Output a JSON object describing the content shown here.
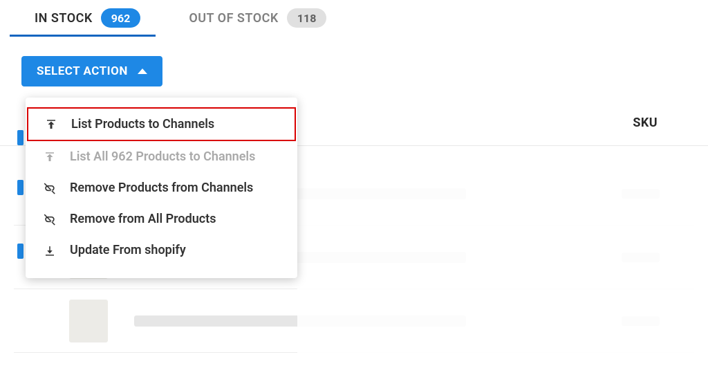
{
  "tabs": {
    "in_stock": {
      "label": "IN STOCK",
      "count": "962"
    },
    "out_of_stock": {
      "label": "OUT OF STOCK",
      "count": "118"
    }
  },
  "select_action": {
    "label": "SELECT ACTION"
  },
  "menu": {
    "list_products": "List Products to Channels",
    "list_all": "List All 962 Products to Channels",
    "remove_products": "Remove Products from Channels",
    "remove_all": "Remove from All Products",
    "update_shopify": "Update From shopify"
  },
  "columns": {
    "sku": "SKU"
  }
}
